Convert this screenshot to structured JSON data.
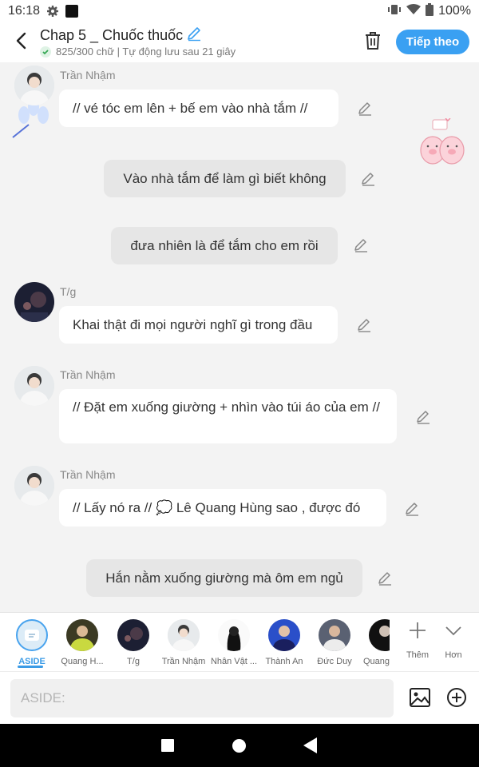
{
  "status_bar": {
    "time": "16:18",
    "battery": "100%"
  },
  "header": {
    "title": "Chap 5 _ Chuốc thuốc",
    "subtitle": "825/300 chữ | Tự động lưu sau 21 giây",
    "next_label": "Tiếp theo"
  },
  "messages": [
    {
      "sender": "Trần Nhậm",
      "text": "// vé tóc em lên + bế em vào nhà tắm //"
    },
    {
      "text": "Vào nhà tắm để làm gì biết không"
    },
    {
      "text": "đưa nhiên là để tắm cho em rồi"
    },
    {
      "sender": "T/g",
      "text": "Khai thật đi mọi người nghĩ gì trong đầu"
    },
    {
      "sender": "Trần Nhậm",
      "text": "// Đặt em xuống giường + nhìn vào túi áo của em //"
    },
    {
      "sender": "Trần Nhậm",
      "text": "// Lấy nó ra // 💭 Lê Quang Hùng sao , được đó"
    },
    {
      "text": "Hắn nằm xuống giường mà ôm em ngủ"
    }
  ],
  "characters": [
    {
      "label": "ASIDE"
    },
    {
      "label": "Quang H..."
    },
    {
      "label": "T/g"
    },
    {
      "label": "Trần Nhậm"
    },
    {
      "label": "Nhân Vật ..."
    },
    {
      "label": "Thành An"
    },
    {
      "label": "Đức Duy"
    },
    {
      "label": "Quang"
    }
  ],
  "tools": {
    "more_label": "Thêm",
    "less_label": "Hơn"
  },
  "input": {
    "placeholder": "ASIDE:"
  },
  "colors": {
    "accent": "#3aa0f2",
    "bubble_white": "#ffffff",
    "bubble_gray": "#e6e6e6",
    "background": "#f3f3f3"
  }
}
